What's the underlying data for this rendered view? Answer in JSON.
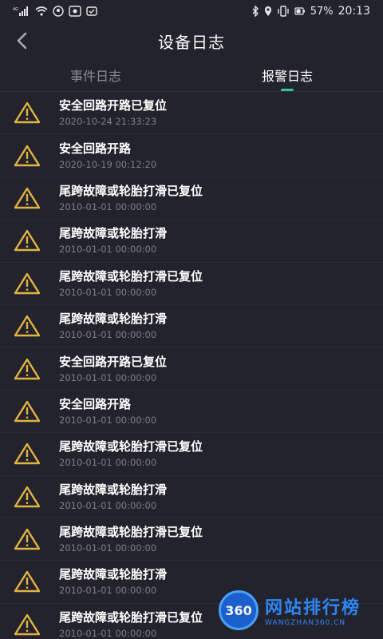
{
  "statusbar": {
    "network": "4G",
    "battery": "57%",
    "time": "20:13"
  },
  "header": {
    "title": "设备日志"
  },
  "tabs": [
    {
      "label": "事件日志",
      "active": false
    },
    {
      "label": "报警日志",
      "active": true
    }
  ],
  "alarms": [
    {
      "event": "安全回路开路已复位",
      "time": "2020-10-24 21:33:23"
    },
    {
      "event": "安全回路开路",
      "time": "2020-10-19 00:12:20"
    },
    {
      "event": "尾跨故障或轮胎打滑已复位",
      "time": "2010-01-01 00:00:00"
    },
    {
      "event": "尾跨故障或轮胎打滑",
      "time": "2010-01-01 00:00:00"
    },
    {
      "event": "尾跨故障或轮胎打滑已复位",
      "time": "2010-01-01 00:00:00"
    },
    {
      "event": "尾跨故障或轮胎打滑",
      "time": "2010-01-01 00:00:00"
    },
    {
      "event": "安全回路开路已复位",
      "time": "2010-01-01 00:00:00"
    },
    {
      "event": "安全回路开路",
      "time": "2010-01-01 00:00:00"
    },
    {
      "event": "尾跨故障或轮胎打滑已复位",
      "time": "2010-01-01 00:00:00"
    },
    {
      "event": "尾跨故障或轮胎打滑",
      "time": "2010-01-01 00:00:00"
    },
    {
      "event": "尾跨故障或轮胎打滑已复位",
      "time": "2010-01-01 00:00:00"
    },
    {
      "event": "尾跨故障或轮胎打滑",
      "time": "2010-01-01 00:00:00"
    },
    {
      "event": "尾跨故障或轮胎打滑已复位",
      "time": "2010-01-01 00:00:00"
    }
  ],
  "watermark": {
    "logo": "360",
    "main": "网站排行榜",
    "sub": "WANGZHAN360.CN"
  },
  "colors": {
    "background": "#23232e",
    "accent": "#2fc98a",
    "warning": "#e3b341"
  }
}
